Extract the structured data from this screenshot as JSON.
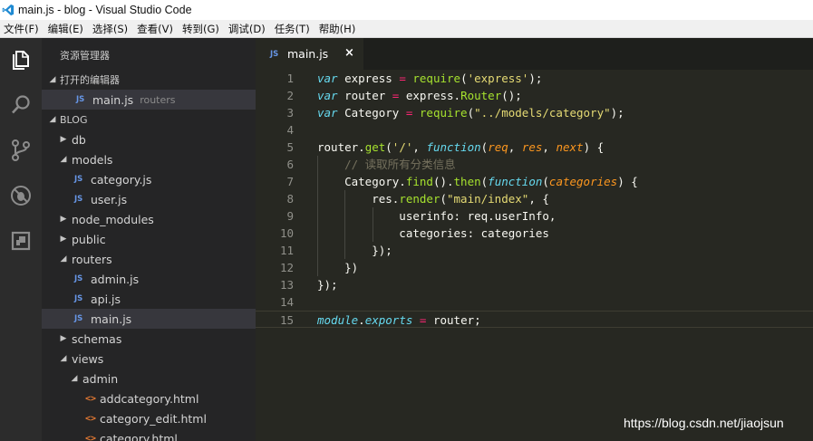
{
  "window": {
    "title": "main.js - blog - Visual Studio Code"
  },
  "menu": [
    "文件(F)",
    "编辑(E)",
    "选择(S)",
    "查看(V)",
    "转到(G)",
    "调试(D)",
    "任务(T)",
    "帮助(H)"
  ],
  "sidebar": {
    "title": "资源管理器",
    "open_editors_header": "打开的编辑器",
    "open_editor": {
      "name": "main.js",
      "folder": "routers"
    },
    "project_header": "BLOG",
    "tree": [
      {
        "name": "db",
        "type": "folder",
        "expanded": false
      },
      {
        "name": "models",
        "type": "folder",
        "expanded": true
      },
      {
        "name": "category.js",
        "type": "js"
      },
      {
        "name": "user.js",
        "type": "js"
      },
      {
        "name": "node_modules",
        "type": "folder",
        "expanded": false
      },
      {
        "name": "public",
        "type": "folder",
        "expanded": false
      },
      {
        "name": "routers",
        "type": "folder",
        "expanded": true
      },
      {
        "name": "admin.js",
        "type": "js"
      },
      {
        "name": "api.js",
        "type": "js"
      },
      {
        "name": "main.js",
        "type": "js",
        "selected": true
      },
      {
        "name": "schemas",
        "type": "folder",
        "expanded": false
      },
      {
        "name": "views",
        "type": "folder",
        "expanded": true
      },
      {
        "name": "admin",
        "type": "folder",
        "expanded": true
      },
      {
        "name": "addcategory.html",
        "type": "html"
      },
      {
        "name": "category_edit.html",
        "type": "html"
      },
      {
        "name": "category.html",
        "type": "html"
      }
    ]
  },
  "icons": {
    "file_badge": "JS",
    "html_badge": "<>",
    "expanded_twisty": "◢",
    "collapsed_twisty": "▶"
  },
  "tab": {
    "label": "main.js",
    "close": "×"
  },
  "editor": {
    "lines": [
      [
        [
          "kw",
          "var"
        ],
        [
          "pl",
          " express "
        ],
        [
          "op",
          "="
        ],
        [
          "pl",
          " "
        ],
        [
          "fn",
          "require"
        ],
        [
          "pl",
          "("
        ],
        [
          "str",
          "'express'"
        ],
        [
          "pl",
          ");"
        ]
      ],
      [
        [
          "kw",
          "var"
        ],
        [
          "pl",
          " router "
        ],
        [
          "op",
          "="
        ],
        [
          "pl",
          " express."
        ],
        [
          "fn",
          "Router"
        ],
        [
          "pl",
          "();"
        ]
      ],
      [
        [
          "kw",
          "var"
        ],
        [
          "pl",
          " Category "
        ],
        [
          "op",
          "="
        ],
        [
          "pl",
          " "
        ],
        [
          "fn",
          "require"
        ],
        [
          "pl",
          "("
        ],
        [
          "str",
          "\"../models/category\""
        ],
        [
          "pl",
          ");"
        ]
      ],
      [],
      [
        [
          "pl",
          "router."
        ],
        [
          "fn",
          "get"
        ],
        [
          "pl",
          "("
        ],
        [
          "str",
          "'/'"
        ],
        [
          "pl",
          ", "
        ],
        [
          "kw",
          "function"
        ],
        [
          "pl",
          "("
        ],
        [
          "par",
          "req"
        ],
        [
          "pl",
          ", "
        ],
        [
          "par",
          "res"
        ],
        [
          "pl",
          ", "
        ],
        [
          "par",
          "next"
        ],
        [
          "pl",
          ") {"
        ]
      ],
      [
        [
          "pl",
          "    "
        ],
        [
          "cm",
          "// 读取所有分类信息"
        ]
      ],
      [
        [
          "pl",
          "    Category."
        ],
        [
          "fn",
          "find"
        ],
        [
          "pl",
          "()."
        ],
        [
          "fn",
          "then"
        ],
        [
          "pl",
          "("
        ],
        [
          "kw",
          "function"
        ],
        [
          "pl",
          "("
        ],
        [
          "par",
          "categories"
        ],
        [
          "pl",
          ") {"
        ]
      ],
      [
        [
          "pl",
          "        res."
        ],
        [
          "fn",
          "render"
        ],
        [
          "pl",
          "("
        ],
        [
          "str",
          "\"main/index\""
        ],
        [
          "pl",
          ", {"
        ]
      ],
      [
        [
          "pl",
          "            userinfo: req.userInfo,"
        ]
      ],
      [
        [
          "pl",
          "            categories: categories"
        ]
      ],
      [
        [
          "pl",
          "        });"
        ]
      ],
      [
        [
          "pl",
          "    })"
        ]
      ],
      [
        [
          "pl",
          "});"
        ]
      ],
      [],
      [
        [
          "kw",
          "module"
        ],
        [
          "pl",
          "."
        ],
        [
          "kw",
          "exports"
        ],
        [
          "pl",
          " "
        ],
        [
          "op",
          "="
        ],
        [
          "pl",
          " router;"
        ]
      ]
    ]
  },
  "watermark": "https://blog.csdn.net/jiaojsun",
  "colors": {
    "background": "#272822",
    "sidebar": "#252526",
    "activitybar": "#2c2c2c",
    "keyword": "#66d9ef",
    "operator": "#f92672",
    "function": "#a6e22e",
    "string": "#e6db74",
    "parameter": "#fd971f",
    "comment": "#75715e"
  }
}
